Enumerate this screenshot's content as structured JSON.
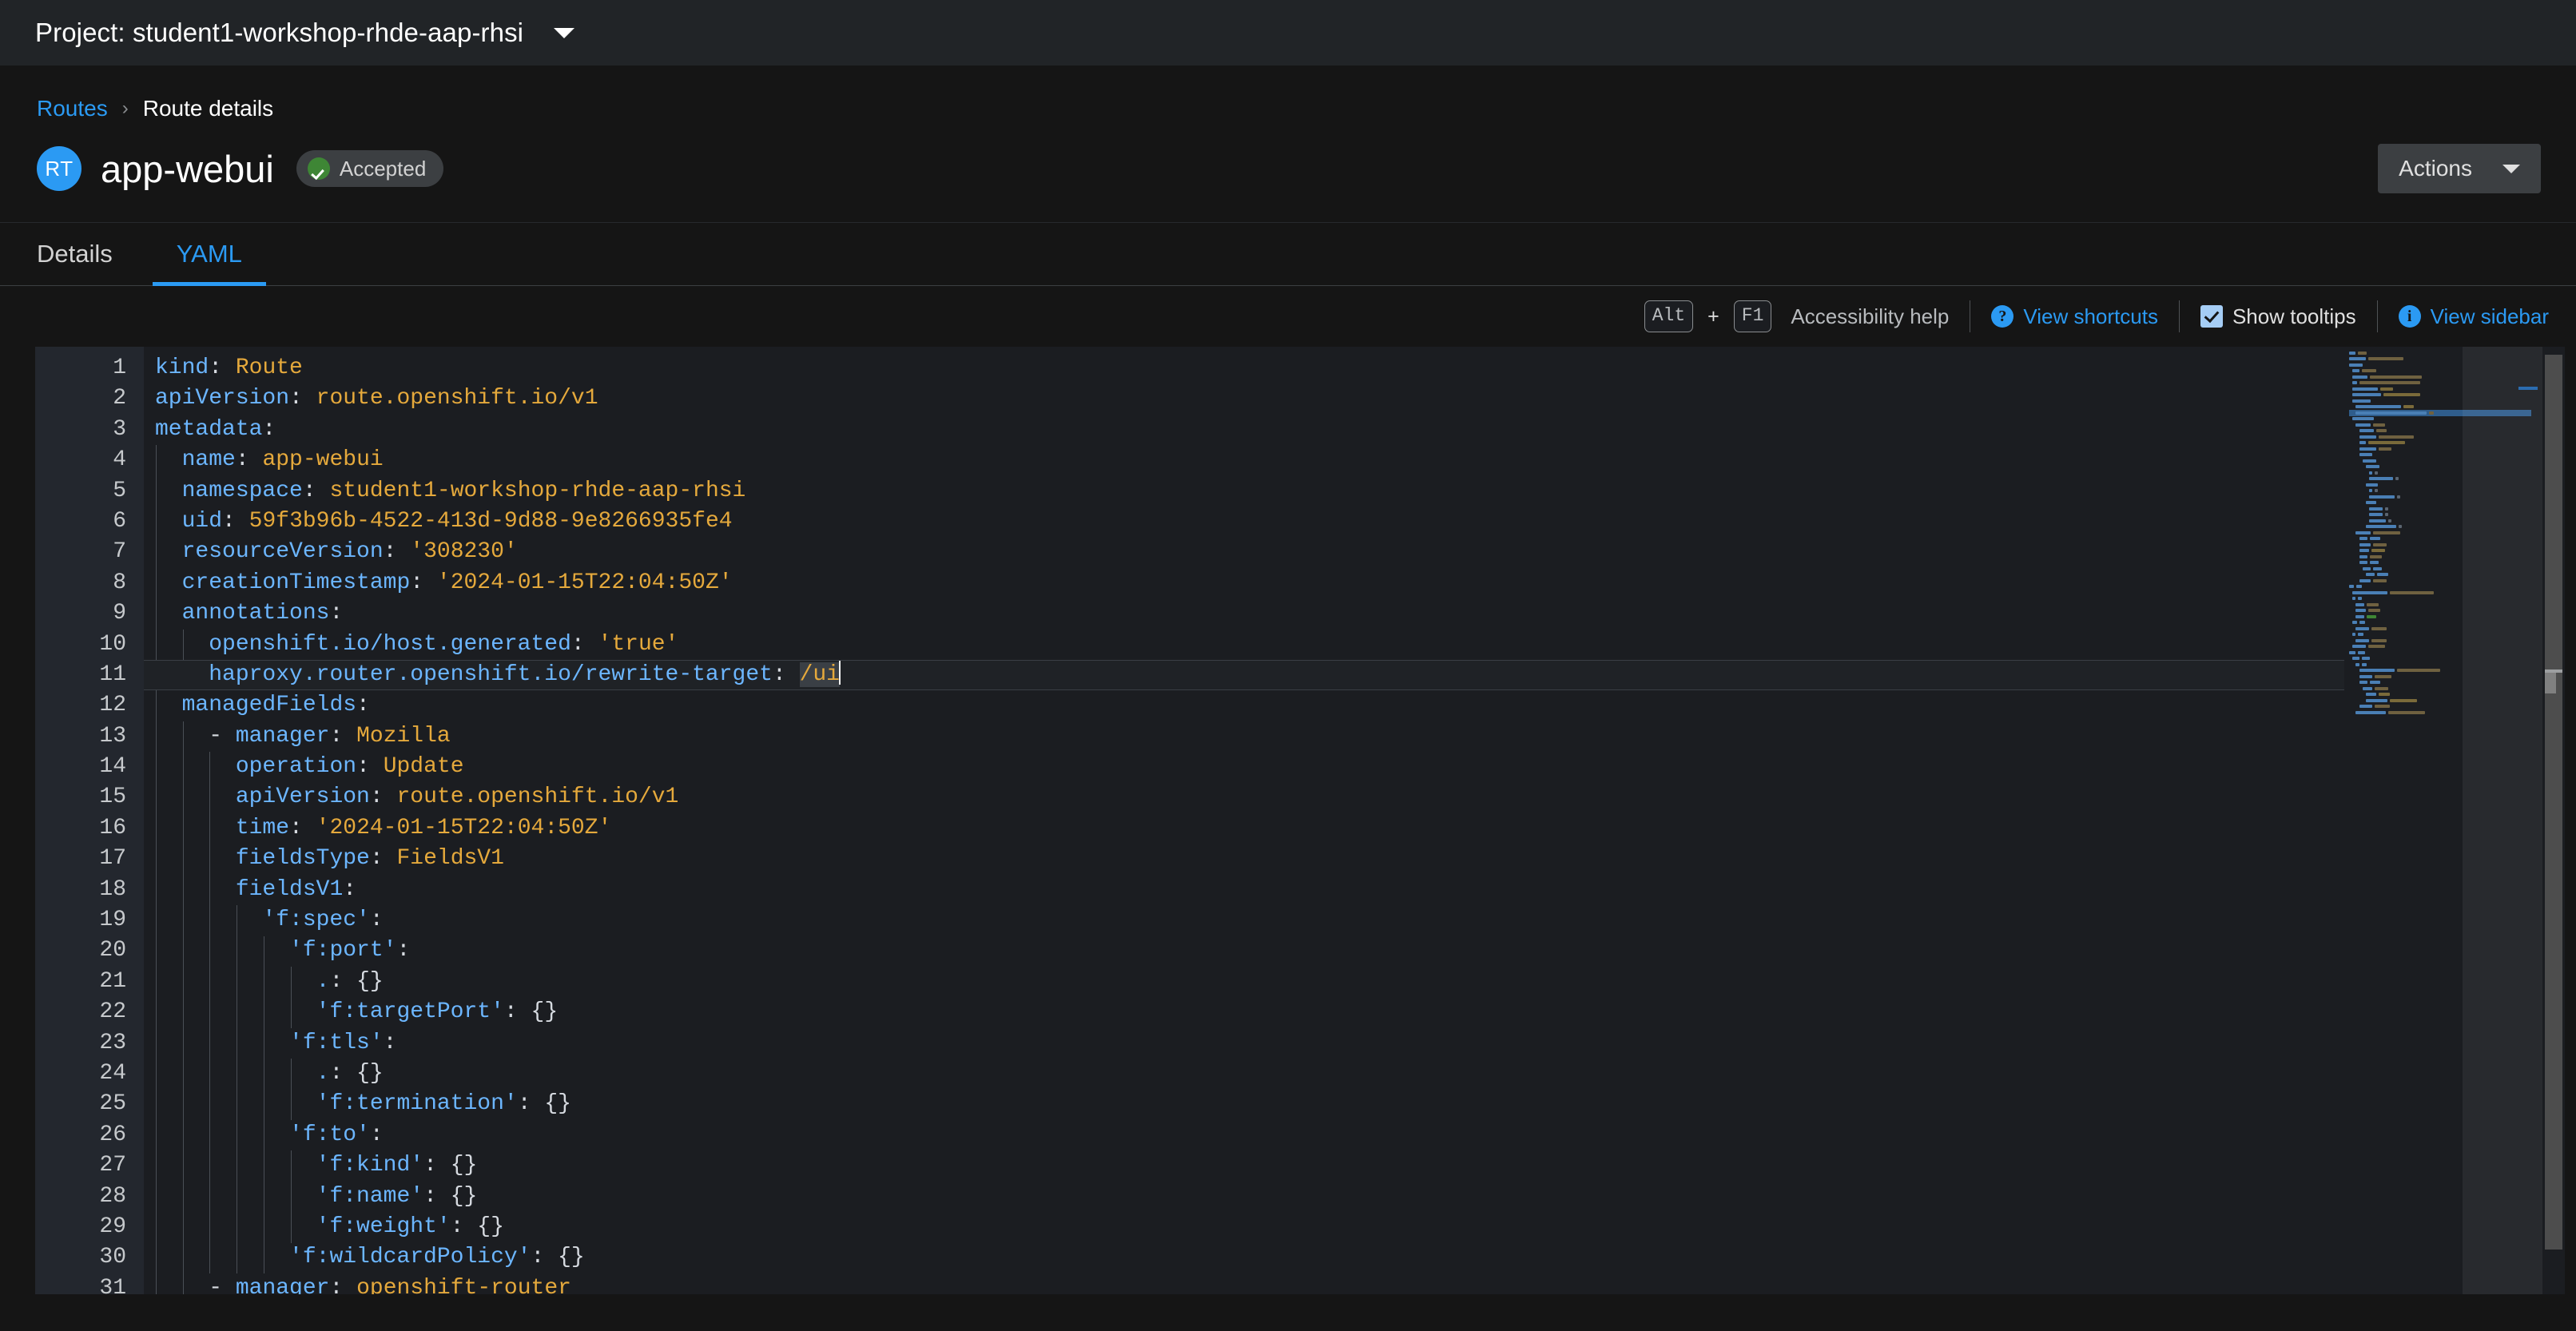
{
  "project_bar": {
    "label": "Project: student1-workshop-rhde-aap-rhsi",
    "caret_icon": "chevron-down-icon"
  },
  "breadcrumb": {
    "parent": "Routes",
    "separator": "›",
    "current": "Route details"
  },
  "header": {
    "badge": "RT",
    "title": "app-webui",
    "status": "Accepted",
    "status_color": "#3e8635",
    "actions_label": "Actions"
  },
  "tabs": [
    {
      "label": "Details",
      "active": false
    },
    {
      "label": "YAML",
      "active": true
    }
  ],
  "editor_toolbar": {
    "kbd_alt": "Alt",
    "kbd_plus": "+",
    "kbd_f1": "F1",
    "accessibility_help": "Accessibility help",
    "view_shortcuts": "View shortcuts",
    "view_shortcuts_icon": "question-circle-icon",
    "show_tooltips": "Show tooltips",
    "show_tooltips_checked": true,
    "view_sidebar": "View sidebar",
    "view_sidebar_icon": "info-circle-icon"
  },
  "editor": {
    "accent_color": "#2b9af3",
    "key_color": "#6cb6ff",
    "value_color": "#e5a93c",
    "cursor_line": 11,
    "cursor_column": 53,
    "first_visible_line": 1,
    "last_visible_line": 31,
    "lines": [
      {
        "n": 1,
        "indent": 0,
        "dash": false,
        "key": "kind",
        "quoted_key": false,
        "value": "Route",
        "value_kind": "plain"
      },
      {
        "n": 2,
        "indent": 0,
        "dash": false,
        "key": "apiVersion",
        "quoted_key": false,
        "value": "route.openshift.io/v1",
        "value_kind": "plain"
      },
      {
        "n": 3,
        "indent": 0,
        "dash": false,
        "key": "metadata",
        "quoted_key": false,
        "value": "",
        "value_kind": "none"
      },
      {
        "n": 4,
        "indent": 1,
        "dash": false,
        "key": "name",
        "quoted_key": false,
        "value": "app-webui",
        "value_kind": "plain"
      },
      {
        "n": 5,
        "indent": 1,
        "dash": false,
        "key": "namespace",
        "quoted_key": false,
        "value": "student1-workshop-rhde-aap-rhsi",
        "value_kind": "plain"
      },
      {
        "n": 6,
        "indent": 1,
        "dash": false,
        "key": "uid",
        "quoted_key": false,
        "value": "59f3b96b-4522-413d-9d88-9e8266935fe4",
        "value_kind": "plain"
      },
      {
        "n": 7,
        "indent": 1,
        "dash": false,
        "key": "resourceVersion",
        "quoted_key": false,
        "value": "'308230'",
        "value_kind": "quoted"
      },
      {
        "n": 8,
        "indent": 1,
        "dash": false,
        "key": "creationTimestamp",
        "quoted_key": false,
        "value": "'2024-01-15T22:04:50Z'",
        "value_kind": "quoted"
      },
      {
        "n": 9,
        "indent": 1,
        "dash": false,
        "key": "annotations",
        "quoted_key": false,
        "value": "",
        "value_kind": "none"
      },
      {
        "n": 10,
        "indent": 2,
        "dash": false,
        "key": "openshift.io/host.generated",
        "quoted_key": false,
        "value": "'true'",
        "value_kind": "quoted"
      },
      {
        "n": 11,
        "indent": 2,
        "dash": false,
        "key": "haproxy.router.openshift.io/rewrite-target",
        "quoted_key": false,
        "value": "/ui",
        "value_kind": "selected"
      },
      {
        "n": 12,
        "indent": 1,
        "dash": false,
        "key": "managedFields",
        "quoted_key": false,
        "value": "",
        "value_kind": "none"
      },
      {
        "n": 13,
        "indent": 2,
        "dash": true,
        "key": "manager",
        "quoted_key": false,
        "value": "Mozilla",
        "value_kind": "plain"
      },
      {
        "n": 14,
        "indent": 3,
        "dash": false,
        "key": "operation",
        "quoted_key": false,
        "value": "Update",
        "value_kind": "plain"
      },
      {
        "n": 15,
        "indent": 3,
        "dash": false,
        "key": "apiVersion",
        "quoted_key": false,
        "value": "route.openshift.io/v1",
        "value_kind": "plain"
      },
      {
        "n": 16,
        "indent": 3,
        "dash": false,
        "key": "time",
        "quoted_key": false,
        "value": "'2024-01-15T22:04:50Z'",
        "value_kind": "quoted"
      },
      {
        "n": 17,
        "indent": 3,
        "dash": false,
        "key": "fieldsType",
        "quoted_key": false,
        "value": "FieldsV1",
        "value_kind": "plain"
      },
      {
        "n": 18,
        "indent": 3,
        "dash": false,
        "key": "fieldsV1",
        "quoted_key": false,
        "value": "",
        "value_kind": "none"
      },
      {
        "n": 19,
        "indent": 4,
        "dash": false,
        "key": "'f:spec'",
        "quoted_key": true,
        "value": "",
        "value_kind": "none"
      },
      {
        "n": 20,
        "indent": 5,
        "dash": false,
        "key": "'f:port'",
        "quoted_key": true,
        "value": "",
        "value_kind": "none"
      },
      {
        "n": 21,
        "indent": 6,
        "dash": false,
        "key": ".",
        "quoted_key": false,
        "value": "{}",
        "value_kind": "brace"
      },
      {
        "n": 22,
        "indent": 6,
        "dash": false,
        "key": "'f:targetPort'",
        "quoted_key": true,
        "value": "{}",
        "value_kind": "brace"
      },
      {
        "n": 23,
        "indent": 5,
        "dash": false,
        "key": "'f:tls'",
        "quoted_key": true,
        "value": "",
        "value_kind": "none"
      },
      {
        "n": 24,
        "indent": 6,
        "dash": false,
        "key": ".",
        "quoted_key": false,
        "value": "{}",
        "value_kind": "brace"
      },
      {
        "n": 25,
        "indent": 6,
        "dash": false,
        "key": "'f:termination'",
        "quoted_key": true,
        "value": "{}",
        "value_kind": "brace"
      },
      {
        "n": 26,
        "indent": 5,
        "dash": false,
        "key": "'f:to'",
        "quoted_key": true,
        "value": "",
        "value_kind": "none"
      },
      {
        "n": 27,
        "indent": 6,
        "dash": false,
        "key": "'f:kind'",
        "quoted_key": true,
        "value": "{}",
        "value_kind": "brace"
      },
      {
        "n": 28,
        "indent": 6,
        "dash": false,
        "key": "'f:name'",
        "quoted_key": true,
        "value": "{}",
        "value_kind": "brace"
      },
      {
        "n": 29,
        "indent": 6,
        "dash": false,
        "key": "'f:weight'",
        "quoted_key": true,
        "value": "{}",
        "value_kind": "brace"
      },
      {
        "n": 30,
        "indent": 5,
        "dash": false,
        "key": "'f:wildcardPolicy'",
        "quoted_key": true,
        "value": "{}",
        "value_kind": "brace"
      },
      {
        "n": 31,
        "indent": 2,
        "dash": true,
        "key": "manager",
        "quoted_key": false,
        "value": "openshift-router",
        "value_kind": "plain"
      }
    ],
    "minimap_overflow_lines": [
      {
        "indent": 3,
        "len": 10,
        "kind": "key"
      },
      {
        "indent": 3,
        "len": 14,
        "kind": "mixed"
      },
      {
        "indent": 3,
        "len": 13,
        "kind": "quoted"
      },
      {
        "indent": 3,
        "len": 11,
        "kind": "mixed"
      },
      {
        "indent": 3,
        "len": 9,
        "kind": "key"
      },
      {
        "indent": 4,
        "len": 9,
        "kind": "key"
      },
      {
        "indent": 5,
        "len": 11,
        "kind": "key"
      },
      {
        "indent": 3,
        "len": 14,
        "kind": "mixed"
      },
      {
        "indent": 0,
        "len": 5,
        "kind": "key"
      },
      {
        "indent": 1,
        "len": 46,
        "kind": "mixed"
      },
      {
        "indent": 1,
        "len": 3,
        "kind": "key"
      },
      {
        "indent": 2,
        "len": 11,
        "kind": "mixed"
      },
      {
        "indent": 2,
        "len": 12,
        "kind": "mixed"
      },
      {
        "indent": 2,
        "len": 10,
        "kind": "green"
      },
      {
        "indent": 1,
        "len": 5,
        "kind": "key"
      },
      {
        "indent": 2,
        "len": 16,
        "kind": "mixed"
      },
      {
        "indent": 1,
        "len": 4,
        "kind": "key"
      },
      {
        "indent": 2,
        "len": 16,
        "kind": "mixed"
      },
      {
        "indent": 1,
        "len": 17,
        "kind": "mixed"
      },
      {
        "indent": 0,
        "len": 7,
        "kind": "key"
      },
      {
        "indent": 1,
        "len": 8,
        "kind": "key"
      },
      {
        "indent": 2,
        "len": 4,
        "kind": "key"
      },
      {
        "indent": 3,
        "len": 46,
        "kind": "mixed"
      },
      {
        "indent": 3,
        "len": 17,
        "kind": "mixed"
      },
      {
        "indent": 3,
        "len": 10,
        "kind": "key"
      },
      {
        "indent": 4,
        "len": 13,
        "kind": "mixed"
      },
      {
        "indent": 5,
        "len": 12,
        "kind": "quoted"
      },
      {
        "indent": 5,
        "len": 28,
        "kind": "quoted"
      },
      {
        "indent": 3,
        "len": 16,
        "kind": "mixed"
      },
      {
        "indent": 2,
        "len": 40,
        "kind": "mixed"
      }
    ]
  }
}
